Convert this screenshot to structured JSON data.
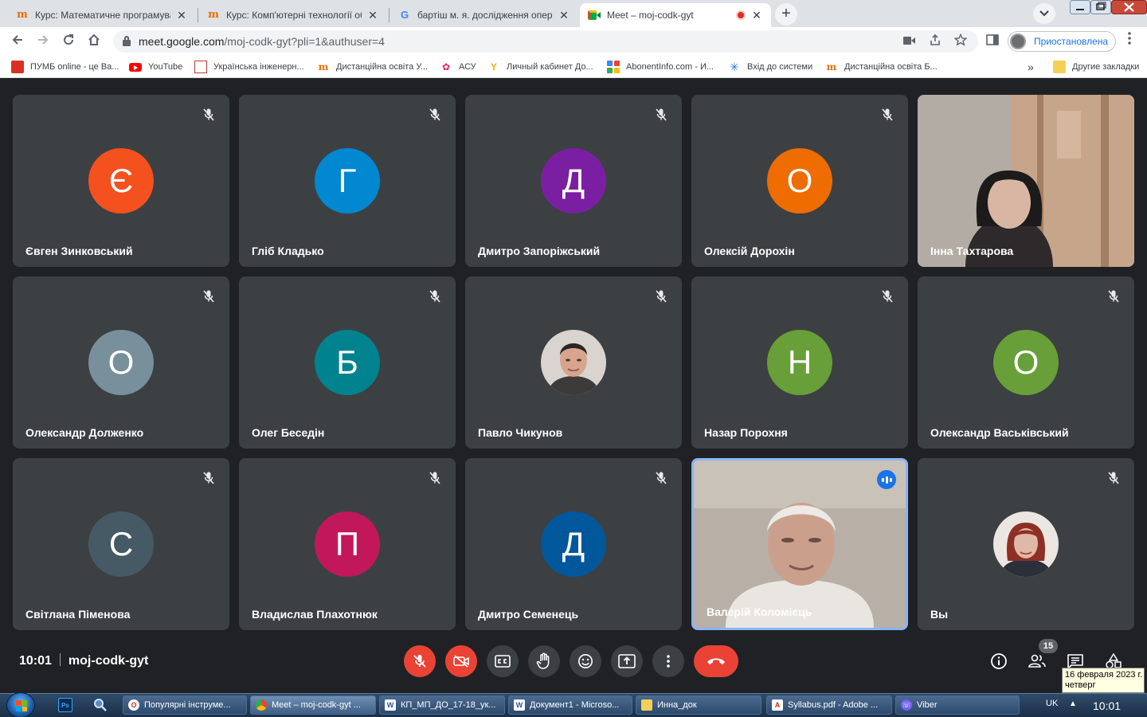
{
  "browser": {
    "tabs": [
      {
        "title": "Курс: Математичне програмування",
        "icon": "moodle-icon"
      },
      {
        "title": "Курс: Комп'ютерні технології обробки",
        "icon": "moodle-icon"
      },
      {
        "title": "бартіш м. я. дослідження операцій",
        "icon": "google-icon"
      },
      {
        "title": "Meet – moj-codk-gyt",
        "icon": "meet-icon"
      }
    ],
    "close_glyph": "✕",
    "new_tab_glyph": "+",
    "url_host": "meet.google.com",
    "url_path": "/moj-codk-gyt?pli=1&authuser=4",
    "profile_status": "Приостановлена",
    "bookmarks": [
      {
        "label": "ПУМБ online - це Ва..."
      },
      {
        "label": "YouTube"
      },
      {
        "label": "Українська інженерн..."
      },
      {
        "label": "Дистанційна освіта У..."
      },
      {
        "label": "АСУ"
      },
      {
        "label": "Личный кабинет До..."
      },
      {
        "label": "AbonentInfo.com - И..."
      },
      {
        "label": "Вхід до системи"
      },
      {
        "label": "Дистанційна освіта Б..."
      }
    ],
    "bookmarks_more": "»",
    "other_bookmarks": "Другие закладки"
  },
  "participants": [
    {
      "name": "Євген Зинковський",
      "initial": "Є",
      "color": "#f4511e"
    },
    {
      "name": "Гліб Кладько",
      "initial": "Г",
      "color": "#0288d1"
    },
    {
      "name": "Дмитро Запоріжський",
      "initial": "Д",
      "color": "#7b1fa2"
    },
    {
      "name": "Олексій Дорохін",
      "initial": "О",
      "color": "#ef6c00"
    },
    {
      "name": "Інна Тахтарова",
      "initial": "",
      "color": "#a9a39c"
    },
    {
      "name": "Олександр Долженко",
      "initial": "О",
      "color": "#78909c"
    },
    {
      "name": "Олег Беседін",
      "initial": "Б",
      "color": "#00838f"
    },
    {
      "name": "Павло Чикунов",
      "initial": "",
      "color": "#c9b8a6"
    },
    {
      "name": "Назар Порохня",
      "initial": "Н",
      "color": "#689f38"
    },
    {
      "name": "Олександр Васьківський",
      "initial": "О",
      "color": "#689f38"
    },
    {
      "name": "Світлана Піменова",
      "initial": "С",
      "color": "#455a64"
    },
    {
      "name": "Владислав Плахотнюк",
      "initial": "П",
      "color": "#c2185b"
    },
    {
      "name": "Дмитро Семенець",
      "initial": "Д",
      "color": "#01579b"
    },
    {
      "name": "Валерій Коломієць",
      "initial": "",
      "color": "#b9b2a8"
    },
    {
      "name": "Вы",
      "initial": "",
      "color": "#e9e1dc"
    }
  ],
  "meeting": {
    "time": "10:01",
    "code": "moj-codk-gyt",
    "participant_count": "15"
  },
  "tooltip": {
    "date": "16 февраля 2023 г.",
    "weekday": "четверг"
  },
  "taskbar": {
    "items": [
      {
        "label": "Популярні інструме..."
      },
      {
        "label": "Meet – moj-codk-gyt ..."
      },
      {
        "label": "КП_МП_ДО_17-18_ук..."
      },
      {
        "label": "Документ1 - Microso..."
      },
      {
        "label": "Инна_док"
      },
      {
        "label": "Syllabus.pdf - Adobe ..."
      },
      {
        "label": "Viber"
      }
    ],
    "language": "UK",
    "clock": "10:01"
  },
  "colors": {
    "meet_background": "#202124",
    "tile_background": "#3c4043",
    "danger_red": "#ea4335",
    "speaking_blue": "#1a73e8"
  }
}
